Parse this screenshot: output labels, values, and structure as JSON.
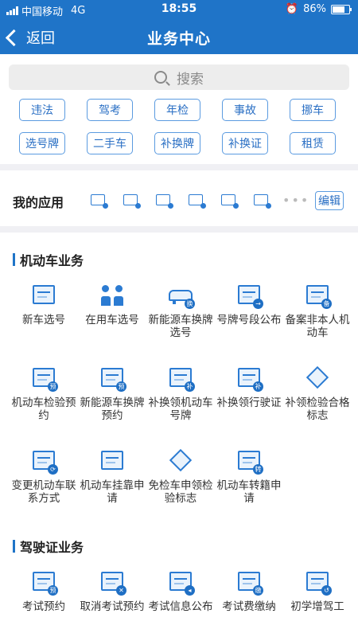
{
  "status": {
    "carrier": "中国移动",
    "network": "4G",
    "time": "18:55",
    "battery": "86%",
    "battery_level": 0.86
  },
  "nav": {
    "back_label": "返回",
    "title": "业务中心"
  },
  "search": {
    "placeholder": "搜索"
  },
  "quick_tags": [
    "违法",
    "驾考",
    "年检",
    "事故",
    "挪车",
    "选号牌",
    "二手车",
    "补换牌",
    "补换证",
    "租赁"
  ],
  "my_apps": {
    "label": "我的应用",
    "more": "•••",
    "edit_label": "编辑",
    "icon_count": 6
  },
  "vehicle_section": {
    "title": "机动车业务",
    "items": [
      {
        "label": "新车选号",
        "icon": "new-plate-icon",
        "type": "doc"
      },
      {
        "label": "在用车选号",
        "icon": "people-car-icon",
        "type": "people"
      },
      {
        "label": "新能源车换牌选号",
        "icon": "ev-car-icon",
        "type": "car",
        "badge": "换"
      },
      {
        "label": "号牌号段公布",
        "icon": "plate-arrow-icon",
        "type": "doc",
        "badge": "→"
      },
      {
        "label": "备案非本人机动车",
        "icon": "file-record-icon",
        "type": "doc",
        "badge": "备"
      },
      {
        "label": "机动车检验预约",
        "icon": "inspection-booking-icon",
        "type": "doc",
        "badge": "预"
      },
      {
        "label": "新能源车换牌预约",
        "icon": "ev-plate-booking-icon",
        "type": "doc",
        "badge": "预"
      },
      {
        "label": "补换领机动车号牌",
        "icon": "plate-replace-icon",
        "type": "doc",
        "badge": "补"
      },
      {
        "label": "补换领行驶证",
        "icon": "license-replace-icon",
        "type": "doc",
        "badge": "补"
      },
      {
        "label": "补领检验合格标志",
        "icon": "inspection-mark-icon",
        "type": "diamond"
      },
      {
        "label": "变更机动车联系方式",
        "icon": "contact-change-icon",
        "type": "doc",
        "badge": "⟳"
      },
      {
        "label": "机动车挂靠申请",
        "icon": "affiliation-icon",
        "type": "doc"
      },
      {
        "label": "免检车申领检验标志",
        "icon": "exempt-mark-icon",
        "type": "diamond"
      },
      {
        "label": "机动车转籍申请",
        "icon": "transfer-icon",
        "type": "doc",
        "badge": "转"
      }
    ]
  },
  "license_section": {
    "title": "驾驶证业务",
    "items": [
      {
        "label": "考试预约",
        "icon": "exam-booking-icon",
        "type": "doc",
        "badge": "预"
      },
      {
        "label": "取消考试预约",
        "icon": "cancel-exam-icon",
        "type": "doc",
        "badge": "✕"
      },
      {
        "label": "考试信息公布",
        "icon": "exam-info-icon",
        "type": "doc",
        "badge": "◂"
      },
      {
        "label": "考试费缴纳",
        "icon": "exam-fee-icon",
        "type": "doc",
        "badge": "缴"
      },
      {
        "label": "初学增驾工",
        "icon": "learner-icon",
        "type": "doc",
        "badge": "↺"
      }
    ]
  }
}
